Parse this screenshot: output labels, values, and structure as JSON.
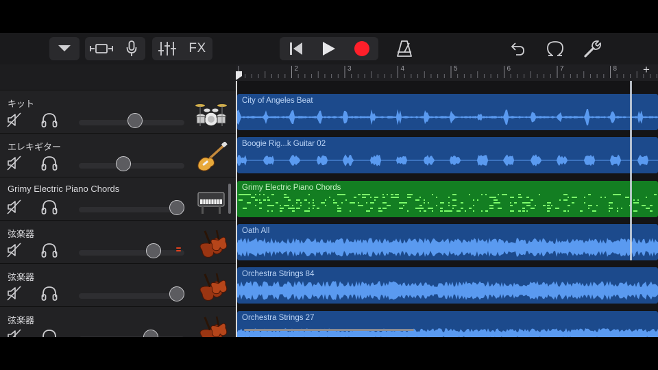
{
  "toolbar": {
    "tracks_menu_icon": "chevron-down-icon",
    "browser_icon": "track-view-icon",
    "mic_icon": "microphone-icon",
    "mixer_icon": "mixer-sliders-icon",
    "fx_label": "FX",
    "rewind_icon": "go-to-beginning-icon",
    "play_icon": "play-icon",
    "record_icon": "record-icon",
    "metronome_icon": "metronome-icon",
    "undo_icon": "undo-icon",
    "loop_icon": "loop-browser-icon",
    "settings_icon": "wrench-icon"
  },
  "colors": {
    "record": "#ff1f2a",
    "audio_region": "#1c4a8c",
    "waveform": "#5a9af0",
    "midi_region": "#137e22",
    "midi_notes": "#7dff6a",
    "level_meter": "#e0421e"
  },
  "ruler": {
    "bars": [
      "2",
      "3",
      "4",
      "5",
      "6",
      "7",
      "8"
    ],
    "add_label": "+"
  },
  "tracks": [
    {
      "name": "キット",
      "instrument": "drum-kit-icon",
      "volume": 0.53,
      "region": "City of Angeles Beat",
      "type": "audio"
    },
    {
      "name": "エレキギター",
      "instrument": "electric-guitar-icon",
      "volume": 0.42,
      "region": "Boogie Rig...k Guitar 02",
      "type": "audio"
    },
    {
      "name": "Grimy Electric Piano Chords",
      "instrument": "electric-piano-icon",
      "volume": 0.93,
      "region": "Grimy Electric Piano Chords",
      "type": "midi"
    },
    {
      "name": "弦楽器",
      "instrument": "violin-icon",
      "volume": 0.71,
      "region": "Oath All",
      "type": "audio",
      "meter": true
    },
    {
      "name": "弦楽器",
      "instrument": "violin-icon",
      "volume": 0.93,
      "region": "Orchestra Strings 84",
      "type": "audio"
    },
    {
      "name": "弦楽器",
      "instrument": "violin-icon",
      "volume": 0.68,
      "region": "Orchestra Strings 27",
      "type": "audio"
    }
  ]
}
